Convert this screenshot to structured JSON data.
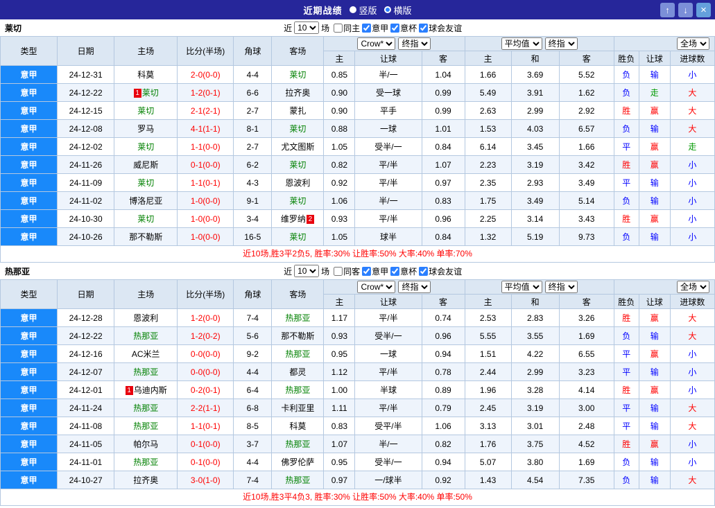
{
  "colors": {
    "titlebar": "#26269a",
    "league_blue": "#1989fa",
    "header_bg": "#dce7f3",
    "alt_row": "#eef4fc",
    "border": "#b4c8e0",
    "red": "#ff0000",
    "blue": "#0000ff",
    "green": "#009900",
    "focus_team": "#008000",
    "badge_red": "#e8000d"
  },
  "title_bar": {
    "title": "近期战绩",
    "layout_options": [
      {
        "label": "竖版",
        "selected": false
      },
      {
        "label": "横版",
        "selected": true
      }
    ],
    "buttons": {
      "up": "↑",
      "down": "↓",
      "close": "×"
    }
  },
  "labels": {
    "near": "近",
    "count": "10",
    "games": "场"
  },
  "columns": {
    "main": [
      "类型",
      "日期",
      "主场",
      "比分(半场)",
      "角球",
      "客场"
    ],
    "odds1_selects": [
      "Crow*",
      "终指"
    ],
    "odds2_selects": [
      "平均值",
      "终指"
    ],
    "scope_select": "全场",
    "sub1": [
      "主",
      "让球",
      "客"
    ],
    "sub2": [
      "主",
      "和",
      "客"
    ],
    "sub3": [
      "胜负",
      "让球",
      "进球数"
    ]
  },
  "result_color_map": {
    "胜": "red",
    "平": "blue",
    "负": "blue",
    "赢": "red",
    "输": "blue",
    "走": "green",
    "大": "red",
    "小": "blue"
  },
  "tables": [
    {
      "team": "莱切",
      "filters": [
        {
          "label": "同主",
          "checked": false
        },
        {
          "label": "意甲",
          "checked": true
        },
        {
          "label": "意杯",
          "checked": true
        },
        {
          "label": "球会友谊",
          "checked": true
        }
      ],
      "rows": [
        {
          "league": "意甲",
          "date": "24-12-31",
          "home": "科莫",
          "away": "莱切",
          "away_focus": true,
          "score": "2-0(0-0)",
          "corners": "4-4",
          "o1": [
            "0.85",
            "半/一",
            "1.04"
          ],
          "o2": [
            "1.66",
            "3.69",
            "5.52"
          ],
          "res": [
            "负",
            "输",
            "小"
          ]
        },
        {
          "league": "意甲",
          "date": "24-12-22",
          "home": "莱切",
          "home_focus": true,
          "home_badge_before": "1",
          "away": "拉齐奥",
          "score": "1-2(0-1)",
          "corners": "6-6",
          "o1": [
            "0.90",
            "受一球",
            "0.99"
          ],
          "o2": [
            "5.49",
            "3.91",
            "1.62"
          ],
          "res": [
            "负",
            "走",
            "大"
          ]
        },
        {
          "league": "意甲",
          "date": "24-12-15",
          "home": "莱切",
          "home_focus": true,
          "away": "蒙扎",
          "score": "2-1(2-1)",
          "corners": "2-7",
          "o1": [
            "0.90",
            "平手",
            "0.99"
          ],
          "o2": [
            "2.63",
            "2.99",
            "2.92"
          ],
          "res": [
            "胜",
            "赢",
            "大"
          ]
        },
        {
          "league": "意甲",
          "date": "24-12-08",
          "home": "罗马",
          "away": "莱切",
          "away_focus": true,
          "score": "4-1(1-1)",
          "corners": "8-1",
          "o1": [
            "0.88",
            "一球",
            "1.01"
          ],
          "o2": [
            "1.53",
            "4.03",
            "6.57"
          ],
          "res": [
            "负",
            "输",
            "大"
          ]
        },
        {
          "league": "意甲",
          "date": "24-12-02",
          "home": "莱切",
          "home_focus": true,
          "away": "尤文图斯",
          "score": "1-1(0-0)",
          "corners": "2-7",
          "o1": [
            "1.05",
            "受半/一",
            "0.84"
          ],
          "o2": [
            "6.14",
            "3.45",
            "1.66"
          ],
          "res": [
            "平",
            "赢",
            "走"
          ]
        },
        {
          "league": "意甲",
          "date": "24-11-26",
          "home": "威尼斯",
          "away": "莱切",
          "away_focus": true,
          "score": "0-1(0-0)",
          "corners": "6-2",
          "o1": [
            "0.82",
            "平/半",
            "1.07"
          ],
          "o2": [
            "2.23",
            "3.19",
            "3.42"
          ],
          "res": [
            "胜",
            "赢",
            "小"
          ]
        },
        {
          "league": "意甲",
          "date": "24-11-09",
          "home": "莱切",
          "home_focus": true,
          "away": "恩波利",
          "score": "1-1(0-1)",
          "corners": "4-3",
          "o1": [
            "0.92",
            "平/半",
            "0.97"
          ],
          "o2": [
            "2.35",
            "2.93",
            "3.49"
          ],
          "res": [
            "平",
            "输",
            "小"
          ]
        },
        {
          "league": "意甲",
          "date": "24-11-02",
          "home": "博洛尼亚",
          "away": "莱切",
          "away_focus": true,
          "score": "1-0(0-0)",
          "corners": "9-1",
          "o1": [
            "1.06",
            "半/一",
            "0.83"
          ],
          "o2": [
            "1.75",
            "3.49",
            "5.14"
          ],
          "res": [
            "负",
            "输",
            "小"
          ]
        },
        {
          "league": "意甲",
          "date": "24-10-30",
          "home": "莱切",
          "home_focus": true,
          "away": "维罗纳",
          "away_badge_after": "2",
          "score": "1-0(0-0)",
          "corners": "3-4",
          "o1": [
            "0.93",
            "平/半",
            "0.96"
          ],
          "o2": [
            "2.25",
            "3.14",
            "3.43"
          ],
          "res": [
            "胜",
            "赢",
            "小"
          ]
        },
        {
          "league": "意甲",
          "date": "24-10-26",
          "home": "那不勒斯",
          "away": "莱切",
          "away_focus": true,
          "score": "1-0(0-0)",
          "corners": "16-5",
          "o1": [
            "1.05",
            "球半",
            "0.84"
          ],
          "o2": [
            "1.32",
            "5.19",
            "9.73"
          ],
          "res": [
            "负",
            "输",
            "小"
          ]
        }
      ],
      "summary": "近10场,胜3平2负5, 胜率:30% 让胜率:50% 大率:40% 单率:70%"
    },
    {
      "team": "热那亚",
      "filters": [
        {
          "label": "同客",
          "checked": false
        },
        {
          "label": "意甲",
          "checked": true
        },
        {
          "label": "意杯",
          "checked": true
        },
        {
          "label": "球会友谊",
          "checked": true
        }
      ],
      "rows": [
        {
          "league": "意甲",
          "date": "24-12-28",
          "home": "恩波利",
          "away": "热那亚",
          "away_focus": true,
          "score": "1-2(0-0)",
          "corners": "7-4",
          "o1": [
            "1.17",
            "平/半",
            "0.74"
          ],
          "o2": [
            "2.53",
            "2.83",
            "3.26"
          ],
          "res": [
            "胜",
            "赢",
            "大"
          ]
        },
        {
          "league": "意甲",
          "date": "24-12-22",
          "home": "热那亚",
          "home_focus": true,
          "away": "那不勒斯",
          "score": "1-2(0-2)",
          "corners": "5-6",
          "o1": [
            "0.93",
            "受半/一",
            "0.96"
          ],
          "o2": [
            "5.55",
            "3.55",
            "1.69"
          ],
          "res": [
            "负",
            "输",
            "大"
          ]
        },
        {
          "league": "意甲",
          "date": "24-12-16",
          "home": "AC米兰",
          "away": "热那亚",
          "away_focus": true,
          "score": "0-0(0-0)",
          "corners": "9-2",
          "o1": [
            "0.95",
            "一球",
            "0.94"
          ],
          "o2": [
            "1.51",
            "4.22",
            "6.55"
          ],
          "res": [
            "平",
            "赢",
            "小"
          ]
        },
        {
          "league": "意甲",
          "date": "24-12-07",
          "home": "热那亚",
          "home_focus": true,
          "away": "都灵",
          "score": "0-0(0-0)",
          "corners": "4-4",
          "o1": [
            "1.12",
            "平/半",
            "0.78"
          ],
          "o2": [
            "2.44",
            "2.99",
            "3.23"
          ],
          "res": [
            "平",
            "输",
            "小"
          ]
        },
        {
          "league": "意甲",
          "date": "24-12-01",
          "home": "乌迪内斯",
          "home_badge_before": "1",
          "away": "热那亚",
          "away_focus": true,
          "score": "0-2(0-1)",
          "corners": "6-4",
          "o1": [
            "1.00",
            "半球",
            "0.89"
          ],
          "o2": [
            "1.96",
            "3.28",
            "4.14"
          ],
          "res": [
            "胜",
            "赢",
            "小"
          ]
        },
        {
          "league": "意甲",
          "date": "24-11-24",
          "home": "热那亚",
          "home_focus": true,
          "away": "卡利亚里",
          "score": "2-2(1-1)",
          "corners": "6-8",
          "o1": [
            "1.11",
            "平/半",
            "0.79"
          ],
          "o2": [
            "2.45",
            "3.19",
            "3.00"
          ],
          "res": [
            "平",
            "输",
            "大"
          ]
        },
        {
          "league": "意甲",
          "date": "24-11-08",
          "home": "热那亚",
          "home_focus": true,
          "away": "科莫",
          "score": "1-1(0-1)",
          "corners": "8-5",
          "o1": [
            "0.83",
            "受平/半",
            "1.06"
          ],
          "o2": [
            "3.13",
            "3.01",
            "2.48"
          ],
          "res": [
            "平",
            "输",
            "大"
          ]
        },
        {
          "league": "意甲",
          "date": "24-11-05",
          "home": "帕尔马",
          "away": "热那亚",
          "away_focus": true,
          "score": "0-1(0-0)",
          "corners": "3-7",
          "o1": [
            "1.07",
            "半/一",
            "0.82"
          ],
          "o2": [
            "1.76",
            "3.75",
            "4.52"
          ],
          "res": [
            "胜",
            "赢",
            "小"
          ]
        },
        {
          "league": "意甲",
          "date": "24-11-01",
          "home": "热那亚",
          "home_focus": true,
          "away": "佛罗伦萨",
          "score": "0-1(0-0)",
          "corners": "4-4",
          "o1": [
            "0.95",
            "受半/一",
            "0.94"
          ],
          "o2": [
            "5.07",
            "3.80",
            "1.69"
          ],
          "res": [
            "负",
            "输",
            "小"
          ]
        },
        {
          "league": "意甲",
          "date": "24-10-27",
          "home": "拉齐奥",
          "away": "热那亚",
          "away_focus": true,
          "score": "3-0(1-0)",
          "corners": "7-4",
          "o1": [
            "0.97",
            "一/球半",
            "0.92"
          ],
          "o2": [
            "1.43",
            "4.54",
            "7.35"
          ],
          "res": [
            "负",
            "输",
            "大"
          ]
        }
      ],
      "summary": "近10场,胜3平4负3, 胜率:30% 让胜率:50% 大率:40% 单率:50%"
    }
  ]
}
